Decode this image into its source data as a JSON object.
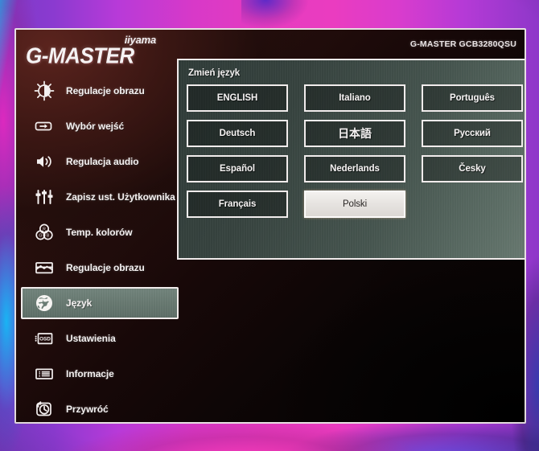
{
  "brand": {
    "sub_logo": "iiyama",
    "main_logo": "G-MASTER",
    "model": "G-MASTER GCB3280QSU"
  },
  "colors": {
    "highlight_bg": "#66776f",
    "panel_bg": "#3b4844",
    "border": "#efeaea",
    "text": "#f5f2f2",
    "active_btn_bg": "#e8e5e2",
    "active_btn_text": "#2a2624",
    "screen_dark": "#170808"
  },
  "sidebar": {
    "items": [
      {
        "label": "Regulacje obrazu",
        "icon": "brightness-contrast-icon",
        "selected": false
      },
      {
        "label": "Wybór wejść",
        "icon": "input-select-icon",
        "selected": false
      },
      {
        "label": "Regulacja audio",
        "icon": "speaker-icon",
        "selected": false
      },
      {
        "label": "Zapisz ust. Użytkownika",
        "icon": "sliders-icon",
        "selected": false
      },
      {
        "label": "Temp. kolorów",
        "icon": "rgb-circles-icon",
        "selected": false
      },
      {
        "label": "Regulacje obrazu",
        "icon": "picture-adjust-icon",
        "selected": false
      },
      {
        "label": "Język",
        "icon": "globe-icon",
        "selected": true
      },
      {
        "label": "Ustawienia",
        "icon": "osd-icon",
        "selected": false
      },
      {
        "label": "Informacje",
        "icon": "information-icon",
        "selected": false
      },
      {
        "label": "Przywróć",
        "icon": "reset-clock-icon",
        "selected": false
      }
    ]
  },
  "language_panel": {
    "title": "Zmień język",
    "selected_language": "Polski",
    "columns": [
      [
        {
          "label": "ENGLISH",
          "active": false,
          "cjk": false
        },
        {
          "label": "Deutsch",
          "active": false,
          "cjk": false
        },
        {
          "label": "Español",
          "active": false,
          "cjk": false
        },
        {
          "label": "Français",
          "active": false,
          "cjk": false
        }
      ],
      [
        {
          "label": "Italiano",
          "active": false,
          "cjk": false
        },
        {
          "label": "日本語",
          "active": false,
          "cjk": true
        },
        {
          "label": "Nederlands",
          "active": false,
          "cjk": false
        },
        {
          "label": "Polski",
          "active": true,
          "cjk": false
        }
      ],
      [
        {
          "label": "Português",
          "active": false,
          "cjk": false
        },
        {
          "label": "Русский",
          "active": false,
          "cjk": false
        },
        {
          "label": "Česky",
          "active": false,
          "cjk": false
        }
      ]
    ]
  }
}
